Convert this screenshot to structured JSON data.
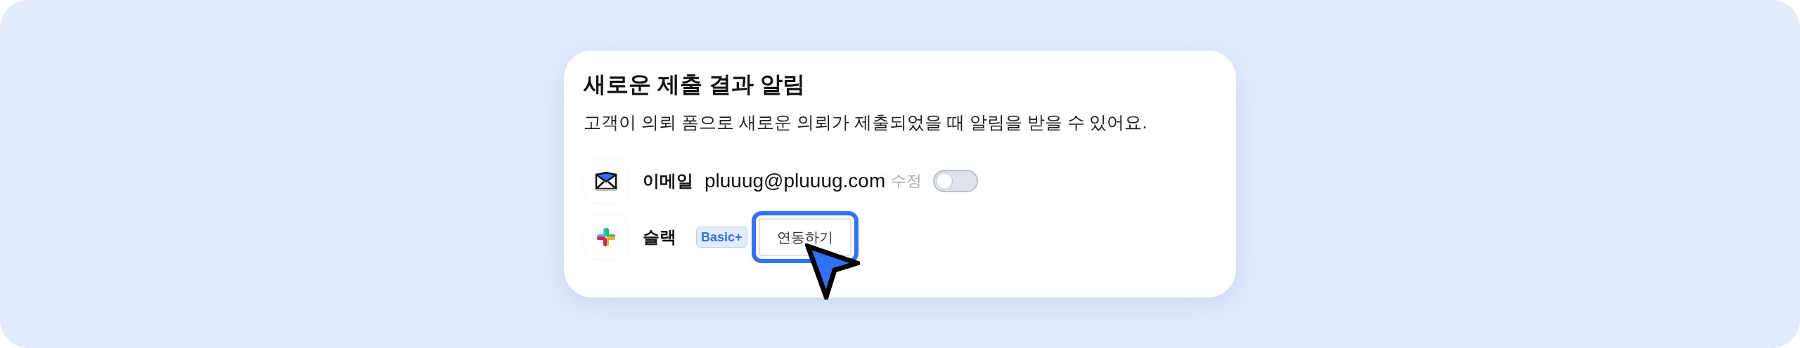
{
  "card": {
    "title": "새로운 제출 결과 알림",
    "description": "고객이 의뢰 폼으로 새로운 의뢰가 제출되었을 때 알림을 받을 수 있어요.",
    "channels": [
      {
        "kind": "email",
        "label": "이메일",
        "value": "pluuug@pluuug.com",
        "action": "수정",
        "on": false
      },
      {
        "kind": "slack",
        "label": "슬랙",
        "badge": "Basic+",
        "button": "연동하기",
        "highlighted": true
      }
    ]
  }
}
